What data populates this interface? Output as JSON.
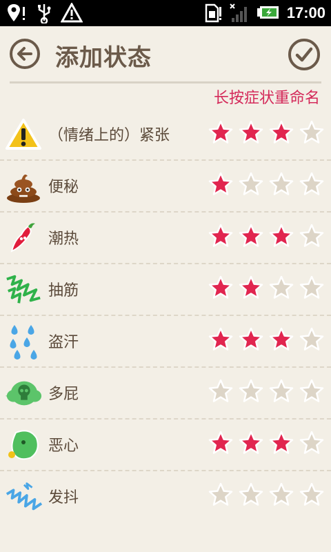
{
  "status_bar": {
    "time": "17:00",
    "icons": [
      "location-alert-icon",
      "usb-icon",
      "warning-icon",
      "sim-icon",
      "signal-icon",
      "battery-charging-icon"
    ]
  },
  "header": {
    "title": "添加状态",
    "back_icon": "arrow-left-icon",
    "confirm_icon": "checkmark-icon"
  },
  "hint": "长按症状重命名",
  "colors": {
    "star_filled": "#e1254f",
    "star_empty": "#ddd5c7",
    "title": "#6b5a4a",
    "hint": "#d42a5a",
    "background": "#f3efe6"
  },
  "symptoms": [
    {
      "label": "（情绪上的）紧张",
      "icon": "warning-triangle-icon",
      "rating": 3
    },
    {
      "label": "便秘",
      "icon": "poop-icon",
      "rating": 1
    },
    {
      "label": "潮热",
      "icon": "chili-pepper-icon",
      "rating": 3
    },
    {
      "label": "抽筋",
      "icon": "cramp-zigzag-icon",
      "rating": 2
    },
    {
      "label": "盗汗",
      "icon": "sweat-drops-icon",
      "rating": 3
    },
    {
      "label": "多屁",
      "icon": "gas-skull-cloud-icon",
      "rating": 0
    },
    {
      "label": "恶心",
      "icon": "nausea-face-icon",
      "rating": 3
    },
    {
      "label": "发抖",
      "icon": "shiver-zigzag-icon",
      "rating": 0
    }
  ],
  "max_rating": 4
}
